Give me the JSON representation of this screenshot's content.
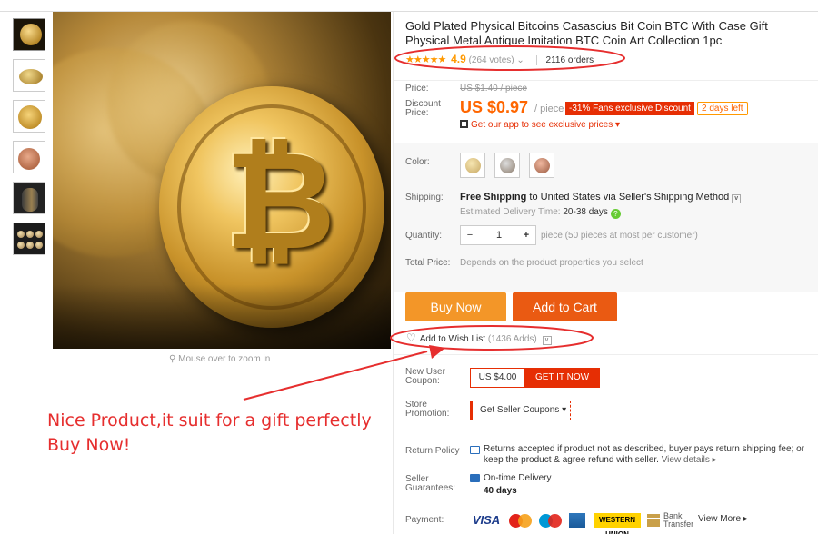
{
  "gallery": {
    "zoom_hint": "Mouse over to zoom in",
    "thumbnails": [
      "thumb-1",
      "thumb-2",
      "thumb-3",
      "thumb-4",
      "thumb-5",
      "thumb-6"
    ]
  },
  "product": {
    "title": "Gold Plated Physical Bitcoins Casascius Bit Coin BTC With Case Gift Physical Metal Antique Imitation BTC Coin Art Collection 1pc",
    "stars": "★★★★★",
    "rating": "4.9",
    "votes": "(264 votes)",
    "orders": "2116 orders"
  },
  "price": {
    "price_label": "Price:",
    "old_price": "US $1.40 / piece",
    "discount_label_1": "Discount",
    "discount_label_2": "Price:",
    "new_price": "US $0.97",
    "unit": "/ piece",
    "discount_tag": "-31% Fans exclusive Discount",
    "days_left": "2 days left",
    "app_link": "Get our app to see exclusive prices"
  },
  "options": {
    "color_label": "Color:",
    "shipping_label": "Shipping:",
    "shipping_bold": "Free Shipping",
    "shipping_rest": "to United States via Seller's Shipping Method",
    "delivery_label": "Estimated Delivery Time:",
    "delivery_value": "20-38 days",
    "quantity_label": "Quantity:",
    "quantity_minus": "−",
    "quantity_value": "1",
    "quantity_plus": "+",
    "quantity_note": "piece (50 pieces at most per customer)",
    "total_label": "Total Price:",
    "total_note": "Depends on the product properties you select"
  },
  "actions": {
    "buy_now": "Buy Now",
    "add_to_cart": "Add to Cart",
    "wish_label": "Add to Wish List",
    "wish_count": "(1436 Adds)"
  },
  "promo": {
    "new_user_label_1": "New User",
    "new_user_label_2": "Coupon:",
    "coupon_value": "US $4.00",
    "coupon_button": "GET IT NOW",
    "store_label_1": "Store",
    "store_label_2": "Promotion:",
    "seller_coupons": "Get Seller Coupons"
  },
  "policy": {
    "return_label": "Return Policy",
    "return_text": "Returns accepted if product not as described, buyer pays return shipping fee; or keep the product & agree refund with seller.",
    "view_details": "View details ▸",
    "guarantee_label_1": "Seller",
    "guarantee_label_2": "Guarantees:",
    "ontime": "On-time Delivery",
    "days": "40 days",
    "payment_label": "Payment:",
    "visa": "VISA",
    "western_union": "WESTERN UNION",
    "bank_1": "Bank",
    "bank_2": "Transfer",
    "view_more": "View More ▸"
  },
  "annotation": {
    "line1": "Nice Product,it suit for a gift perfectly",
    "line2": "Buy Now!",
    "color": "#e62e2e"
  }
}
